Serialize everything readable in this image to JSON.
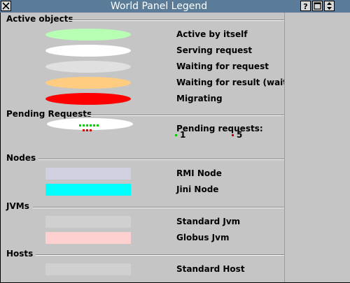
{
  "window": {
    "title": "World Panel Legend"
  },
  "colors": {
    "titlebar": "#5b7c98",
    "background": "#c5c5c5"
  },
  "titlebar_buttons": [
    "close-icon",
    "help-icon",
    "maximize-icon",
    "shade-icon"
  ],
  "sections": {
    "active_objects": {
      "title": "Active objects",
      "items": [
        {
          "label": "Active by itself",
          "color": "#b6ffb3"
        },
        {
          "label": "Serving request",
          "color": "#ffffff"
        },
        {
          "label": "Waiting for request",
          "color": "#e0e0e0"
        },
        {
          "label": "Waiting for result (wait b",
          "color": "#ffcc80"
        },
        {
          "label": "Migrating",
          "color": "#ff0000"
        }
      ]
    },
    "pending_requests": {
      "title": "Pending Requests",
      "label": "Pending requests:",
      "green_count": "1",
      "red_count": "5"
    },
    "nodes": {
      "title": "Nodes",
      "items": [
        {
          "label": "RMI Node",
          "color": "#d0d0e0"
        },
        {
          "label": "Jini Node",
          "color": "#00ffff"
        }
      ]
    },
    "jvms": {
      "title": "JVMs",
      "items": [
        {
          "label": "Standard Jvm",
          "color": "#d0d0d0"
        },
        {
          "label": "Globus Jvm",
          "color": "#ffd0d0"
        }
      ]
    },
    "hosts": {
      "title": "Hosts",
      "items": [
        {
          "label": "Standard Host",
          "color": "#d0d0d0"
        }
      ]
    }
  }
}
